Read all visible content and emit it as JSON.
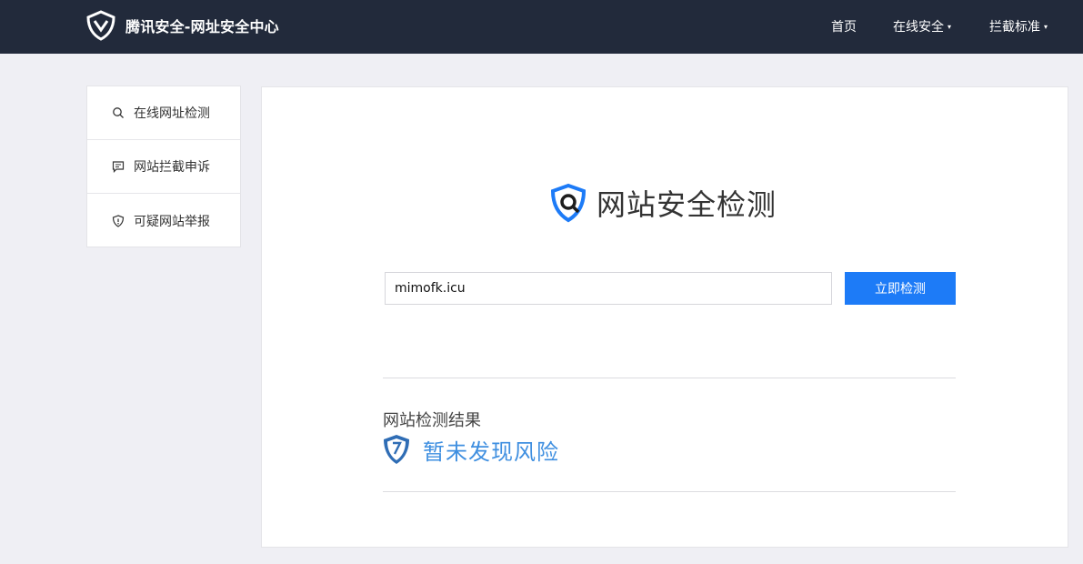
{
  "header": {
    "brand_name": "腾讯安全-网址安全中心",
    "nav": [
      {
        "label": "首页"
      },
      {
        "label": "在线安全"
      },
      {
        "label": "拦截标准"
      }
    ],
    "caret": "▾"
  },
  "sidebar": {
    "items": [
      {
        "label": "在线网址检测",
        "icon": "search-icon"
      },
      {
        "label": "网站拦截申诉",
        "icon": "message-icon"
      },
      {
        "label": "可疑网站举报",
        "icon": "shield-alert-icon"
      }
    ]
  },
  "main": {
    "title": "网站安全检测",
    "url_value": "mimofk.icu",
    "check_button": "立即检测",
    "result_label": "网站检测结果",
    "result_text": "暂未发现风险"
  },
  "colors": {
    "topbar": "#222a3b",
    "accent": "#1d7bf7",
    "result_blue": "#3f8fe0"
  }
}
